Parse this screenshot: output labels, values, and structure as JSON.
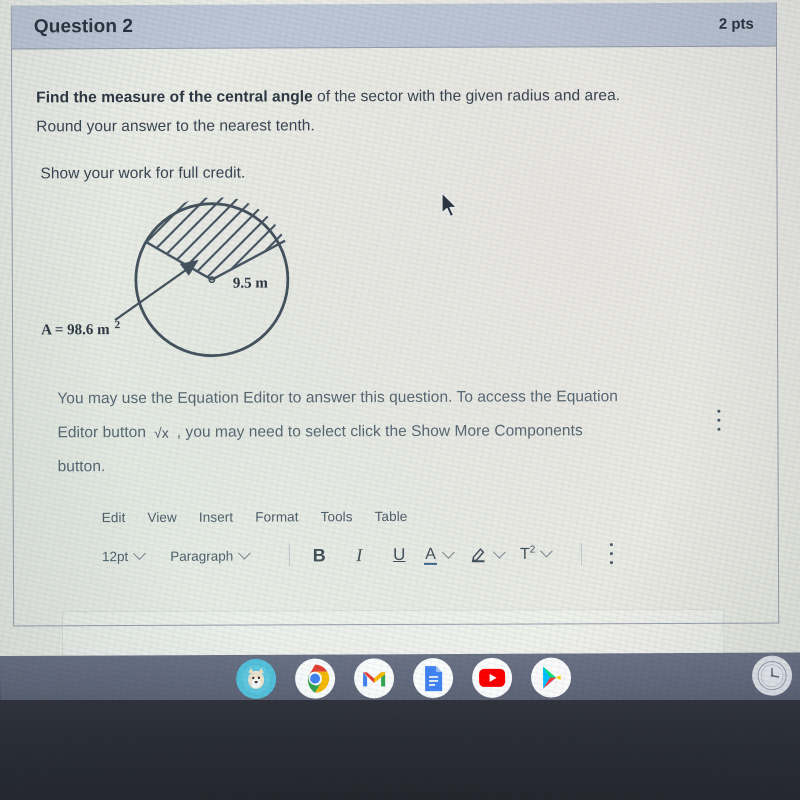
{
  "question": {
    "title": "Question 2",
    "points": "2 pts",
    "prompt_bold": "Find the measure of the central angle",
    "prompt_rest": " of the sector with the given radius and area.",
    "prompt_line2": "Round your answer to the nearest tenth.",
    "prompt_line3": "Show your work for full credit."
  },
  "figure": {
    "area_label": "A = 98.6 m",
    "area_exponent": "2",
    "radius_label": "9.5 m",
    "shape": "circle-with-hatched-sector"
  },
  "instructions": {
    "line1": "You may use the Equation Editor to answer this question. To access the Equation",
    "line2_before": "Editor button",
    "equation_icon": "√x",
    "line2_after": ", you may need to select click the Show More Components",
    "line3": "button.",
    "more_components_icon": "kebab-menu-icon"
  },
  "rce": {
    "menubar": [
      {
        "label": "Edit"
      },
      {
        "label": "View"
      },
      {
        "label": "Insert"
      },
      {
        "label": "Format"
      },
      {
        "label": "Tools"
      },
      {
        "label": "Table"
      }
    ],
    "font_size": "12pt",
    "block_format": "Paragraph",
    "buttons": [
      {
        "label": "B",
        "name": "bold-button"
      },
      {
        "label": "I",
        "name": "italic-button"
      },
      {
        "label": "U",
        "name": "underline-button"
      }
    ],
    "text_color_glyph": "A",
    "highlight_glyph": "highlighter-pen-icon",
    "superscript_glyph": "T",
    "superscript_exponent": "2",
    "overflow_icon": "kebab-menu-icon",
    "editor_placeholder": ""
  },
  "shelf": {
    "apps": [
      {
        "name": "launcher-shiba-icon",
        "label": "Launcher"
      },
      {
        "name": "chrome-icon",
        "label": "Chrome"
      },
      {
        "name": "gmail-icon",
        "label": "Gmail"
      },
      {
        "name": "google-docs-icon",
        "label": "Docs"
      },
      {
        "name": "youtube-icon",
        "label": "YouTube"
      },
      {
        "name": "google-play-icon",
        "label": "Play Store"
      }
    ],
    "status_icon": "clock-icon"
  },
  "colors": {
    "header_bg": "#bfcad9",
    "header_text": "#2a3340",
    "body_text": "#3b4654",
    "muted_text": "#5b6b77",
    "shelf_bg": "#656c80",
    "page_bg": "#eef0ea",
    "figure_ink": "#4a5866"
  }
}
